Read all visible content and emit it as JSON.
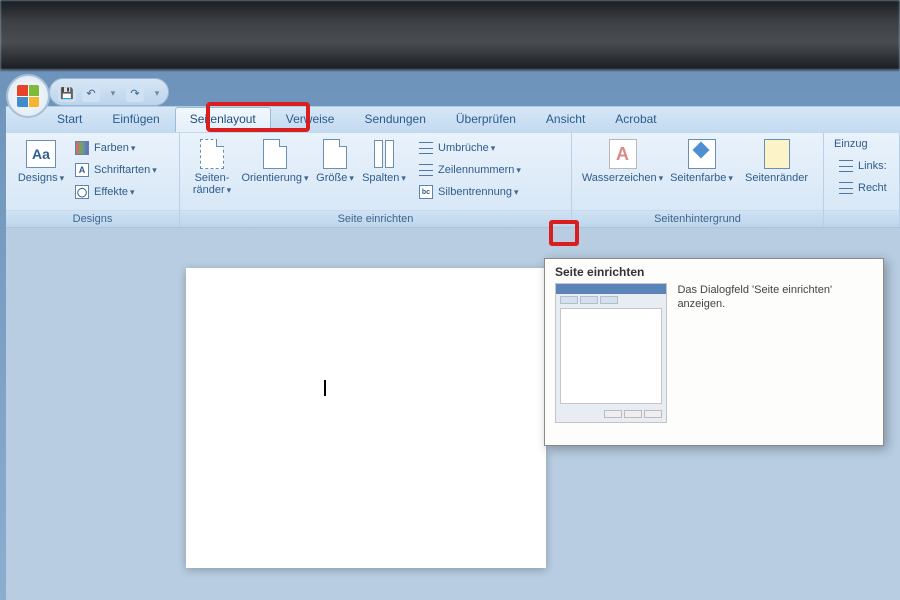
{
  "qat": {
    "save": "💾",
    "undo": "↶",
    "redo": "↷"
  },
  "tabs": {
    "start": "Start",
    "insert": "Einfügen",
    "pagelayout": "Seitenlayout",
    "references": "Verweise",
    "mailings": "Sendungen",
    "review": "Überprüfen",
    "view": "Ansicht",
    "acrobat": "Acrobat"
  },
  "groups": {
    "designs": {
      "label": "Designs",
      "designs_btn": "Designs",
      "colors": "Farben",
      "fonts": "Schriftarten",
      "effects": "Effekte"
    },
    "pagesetup": {
      "label": "Seite einrichten",
      "margins": "Seiten-\nränder",
      "orientation": "Orientierung",
      "size": "Größe",
      "columns": "Spalten",
      "breaks": "Umbrüche",
      "linenumbers": "Zeilennummern",
      "hyphenation": "Silbentrennung"
    },
    "background": {
      "label": "Seitenhintergrund",
      "watermark": "Wasserzeichen",
      "pagecolor": "Seitenfarbe",
      "pageborders": "Seitenränder"
    },
    "indent": {
      "label": "Einzug",
      "left": "Links:",
      "right": "Recht"
    }
  },
  "tooltip": {
    "title": "Seite einrichten",
    "text": "Das Dialogfeld 'Seite einrichten' anzeigen."
  }
}
